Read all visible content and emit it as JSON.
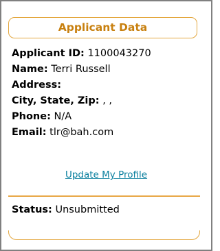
{
  "panel": {
    "title": "Applicant Data",
    "accent_color": "#e3a63d",
    "title_color": "#c8800f"
  },
  "applicant": {
    "id_label": "Applicant ID:",
    "id_value": "1100043270",
    "name_label": "Name:",
    "name_value": "Terri Russell",
    "address_label": "Address:",
    "address_value": "",
    "csz_label": "City, State, Zip:",
    "csz_value": ", ,",
    "phone_label": "Phone:",
    "phone_value": "N/A",
    "email_label": "Email:",
    "email_value": "tlr@bah.com"
  },
  "links": {
    "update_profile": "Update My Profile"
  },
  "status": {
    "label": "Status:",
    "value": "Unsubmitted"
  }
}
